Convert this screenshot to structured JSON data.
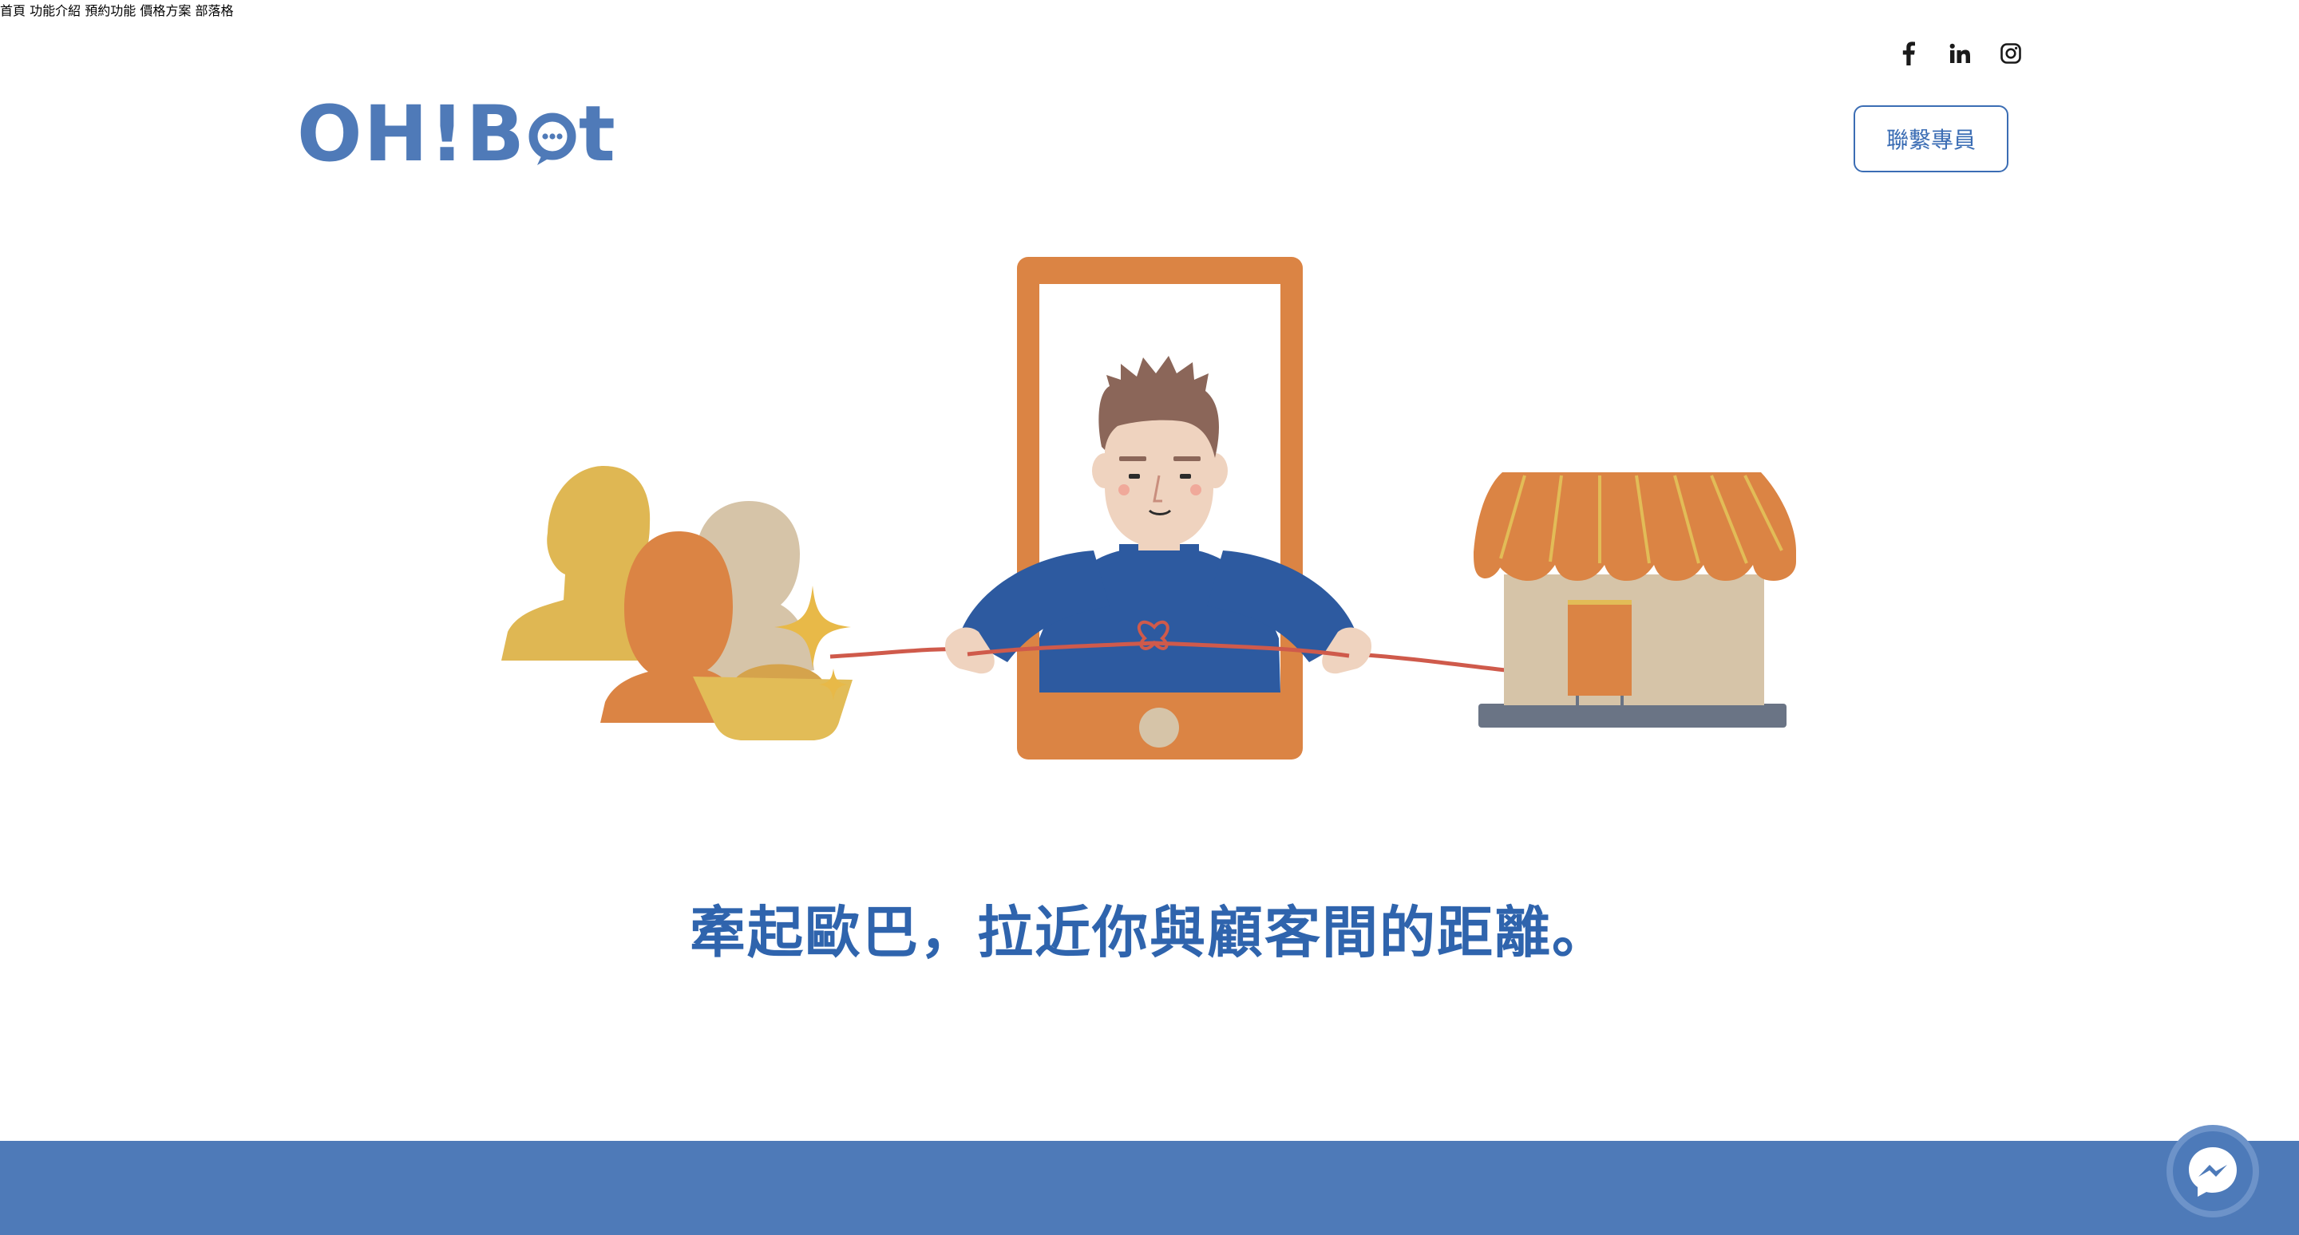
{
  "header": {
    "logo": {
      "text_left": "OH!B",
      "text_right": "t",
      "icon": "chat-bubble-icon"
    },
    "social": [
      {
        "name": "facebook",
        "icon": "facebook-icon"
      },
      {
        "name": "linkedin",
        "icon": "linkedin-icon"
      },
      {
        "name": "instagram",
        "icon": "instagram-icon"
      }
    ],
    "nav": {
      "home": "首頁",
      "features": "功能介紹",
      "booking": "預約功能",
      "pricing": "價格方案",
      "blog": "部落格"
    },
    "contact_button": "聯繫專員"
  },
  "hero": {
    "tagline": "牽起歐巴，拉近你與顧客間的距離。"
  },
  "colors": {
    "brand_blue": "#3b6db4",
    "logo_blue": "#4f7ab8",
    "band_blue": "#4e7ab8",
    "orange": "#dc8543",
    "gold": "#e0b652"
  },
  "floating": {
    "messenger_icon": "messenger-icon"
  }
}
